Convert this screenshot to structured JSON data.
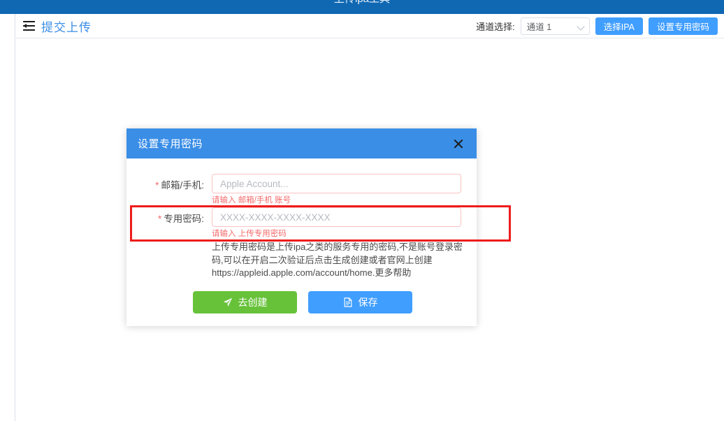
{
  "window": {
    "top_bar_title": "上传ipa工具"
  },
  "header": {
    "fold_icon": "menu-fold-icon",
    "page_title": "提交上传",
    "channel_label": "通道选择:",
    "channel_selected": "通道 1",
    "channel_options": [
      "通道 1"
    ],
    "select_ipa_button": "选择IPA",
    "set_password_button": "设置专用密码"
  },
  "dialog": {
    "title": "设置专用密码",
    "close_icon": "close-icon",
    "fields": [
      {
        "label": "邮箱/手机:",
        "required": true,
        "value": "",
        "placeholder": "Apple Account...",
        "error": "请输入 邮箱/手机 账号"
      },
      {
        "label": "专用密码:",
        "required": true,
        "value": "",
        "placeholder": "XXXX-XXXX-XXXX-XXXX",
        "error": "请输入 上传专用密码"
      }
    ],
    "help_text": "上传专用密码是上传ipa之类的服务专用的密码,不是账号登录密码,可以在开启二次验证后点击生成创建或者官网上创建 https://appleid.apple.com/account/home.更多帮助",
    "buttons": {
      "create_label": "去创建",
      "create_icon": "paper-plane-icon",
      "save_label": "保存",
      "save_icon": "document-icon"
    }
  },
  "annotation": {
    "type": "red-highlight-rectangle",
    "color": "#ee1c1c",
    "target": "专用密码 field row"
  },
  "colors": {
    "top_bar": "#1068b3",
    "dialog_header": "#3a8ee6",
    "primary_blue": "#409eff",
    "green": "#67c23a",
    "error_red": "#f56c6c",
    "annotation_red": "#ee1c1c",
    "title_blue": "#3a8ee6"
  }
}
